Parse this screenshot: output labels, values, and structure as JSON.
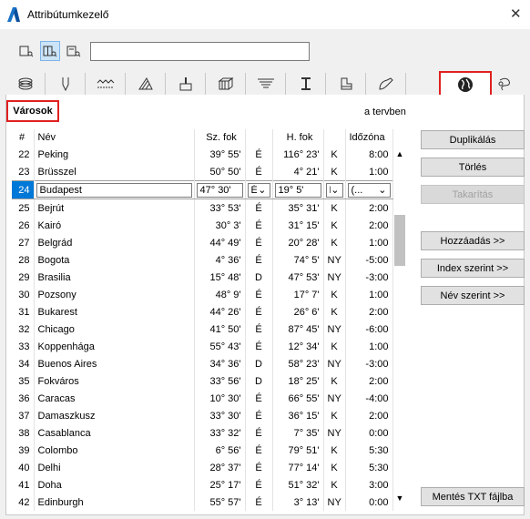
{
  "window": {
    "title": "Attribútumkezelő",
    "close": "✕"
  },
  "toolbar": {
    "search_value": ""
  },
  "tabs": [
    {
      "icon": "layers-icon"
    },
    {
      "icon": "pen-icon"
    },
    {
      "icon": "line-type-icon"
    },
    {
      "icon": "fill-icon"
    },
    {
      "icon": "paint-icon"
    },
    {
      "icon": "composite-icon"
    },
    {
      "icon": "zone-icon"
    },
    {
      "icon": "profile-icon"
    },
    {
      "icon": "building-material-icon"
    },
    {
      "icon": "surface-icon"
    },
    {
      "icon": "globe-icon",
      "active": true
    },
    {
      "icon": "mep-icon"
    }
  ],
  "section": {
    "title": "Városok",
    "scope": "a tervben"
  },
  "table": {
    "headers": {
      "index": "#",
      "name": "Név",
      "lat": "Sz. fok",
      "lon": "H. fok",
      "tz": "Időzóna"
    },
    "rows": [
      {
        "i": "22",
        "name": "Peking",
        "lat": "39° 55'",
        "ns": "É",
        "lon": "116° 23'",
        "ew": "K",
        "tz": "8:00"
      },
      {
        "i": "23",
        "name": "Brüsszel",
        "lat": "50° 50'",
        "ns": "É",
        "lon": "4° 21'",
        "ew": "K",
        "tz": "1:00"
      },
      {
        "i": "24",
        "name": "Budapest",
        "lat": "47° 30'",
        "ns": "É",
        "lon": "19° 5'",
        "ew": "K",
        "tz": "(...",
        "selected": true
      },
      {
        "i": "25",
        "name": "Bejrút",
        "lat": "33° 53'",
        "ns": "É",
        "lon": "35° 31'",
        "ew": "K",
        "tz": "2:00"
      },
      {
        "i": "26",
        "name": "Kairó",
        "lat": "30° 3'",
        "ns": "É",
        "lon": "31° 15'",
        "ew": "K",
        "tz": "2:00"
      },
      {
        "i": "27",
        "name": "Belgrád",
        "lat": "44° 49'",
        "ns": "É",
        "lon": "20° 28'",
        "ew": "K",
        "tz": "1:00"
      },
      {
        "i": "28",
        "name": "Bogota",
        "lat": "4° 36'",
        "ns": "É",
        "lon": "74° 5'",
        "ew": "NY",
        "tz": "-5:00"
      },
      {
        "i": "29",
        "name": "Brasilia",
        "lat": "15° 48'",
        "ns": "D",
        "lon": "47° 53'",
        "ew": "NY",
        "tz": "-3:00"
      },
      {
        "i": "30",
        "name": "Pozsony",
        "lat": "48° 9'",
        "ns": "É",
        "lon": "17° 7'",
        "ew": "K",
        "tz": "1:00"
      },
      {
        "i": "31",
        "name": "Bukarest",
        "lat": "44° 26'",
        "ns": "É",
        "lon": "26° 6'",
        "ew": "K",
        "tz": "2:00"
      },
      {
        "i": "32",
        "name": "Chicago",
        "lat": "41° 50'",
        "ns": "É",
        "lon": "87° 45'",
        "ew": "NY",
        "tz": "-6:00"
      },
      {
        "i": "33",
        "name": "Koppenhága",
        "lat": "55° 43'",
        "ns": "É",
        "lon": "12° 34'",
        "ew": "K",
        "tz": "1:00"
      },
      {
        "i": "34",
        "name": "Buenos Aires",
        "lat": "34° 36'",
        "ns": "D",
        "lon": "58° 23'",
        "ew": "NY",
        "tz": "-3:00"
      },
      {
        "i": "35",
        "name": "Fokváros",
        "lat": "33° 56'",
        "ns": "D",
        "lon": "18° 25'",
        "ew": "K",
        "tz": "2:00"
      },
      {
        "i": "36",
        "name": "Caracas",
        "lat": "10° 30'",
        "ns": "É",
        "lon": "66° 55'",
        "ew": "NY",
        "tz": "-4:00"
      },
      {
        "i": "37",
        "name": "Damaszkusz",
        "lat": "33° 30'",
        "ns": "É",
        "lon": "36° 15'",
        "ew": "K",
        "tz": "2:00"
      },
      {
        "i": "38",
        "name": "Casablanca",
        "lat": "33° 32'",
        "ns": "É",
        "lon": "7° 35'",
        "ew": "NY",
        "tz": "0:00"
      },
      {
        "i": "39",
        "name": "Colombo",
        "lat": "6° 56'",
        "ns": "É",
        "lon": "79° 51'",
        "ew": "K",
        "tz": "5:30"
      },
      {
        "i": "40",
        "name": "Delhi",
        "lat": "28° 37'",
        "ns": "É",
        "lon": "77° 14'",
        "ew": "K",
        "tz": "5:30"
      },
      {
        "i": "41",
        "name": "Doha",
        "lat": "25° 17'",
        "ns": "É",
        "lon": "51° 32'",
        "ew": "K",
        "tz": "3:00"
      },
      {
        "i": "42",
        "name": "Edinburgh",
        "lat": "55° 57'",
        "ns": "É",
        "lon": "3° 13'",
        "ew": "NY",
        "tz": "0:00"
      }
    ]
  },
  "buttons": {
    "duplicate": "Duplikálás",
    "delete": "Törlés",
    "purge": "Takarítás",
    "add": "Hozzáadás >>",
    "by_index": "Index szerint >>",
    "by_name": "Név szerint >>",
    "save_txt": "Mentés TXT fájlba"
  }
}
